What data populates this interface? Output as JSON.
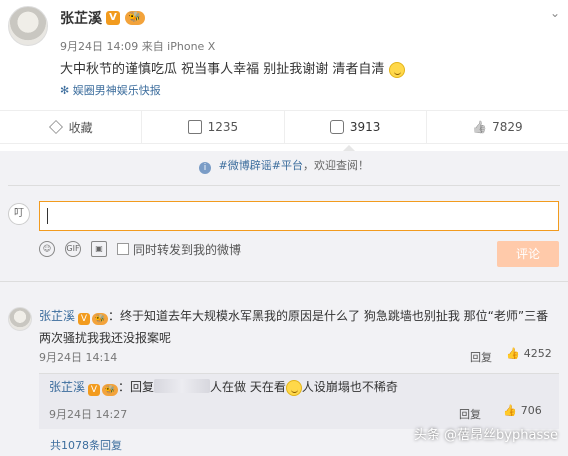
{
  "post": {
    "author": "张芷溪",
    "verified_badge": "V",
    "level_badge": "🐝",
    "meta": "9月24日 14:09 来自 iPhone X",
    "text": "大中秋节的谨慎吃瓜 祝当事人幸福 别扯我谢谢 清者自清",
    "source": "娱圈男神娱乐快报",
    "menu_icon": "chevron-down-icon"
  },
  "actions": {
    "favorite": "收藏",
    "share": "1235",
    "comment": "3913",
    "like": "7829"
  },
  "comments": {
    "notice_prefix": "",
    "notice_link": "#微博辟谣#平台",
    "notice_suffix": "，欢迎查阅！",
    "avatar_text": "叮",
    "input_value": "",
    "forward_label": "同时转发到我的微博",
    "submit": "评论",
    "first": {
      "author": "张芷溪",
      "text": "：终于知道去年大规模水军黑我的原因是什么了 狗急跳墙也别扯我 那位“老师”三番两次骚扰我我还没报案呢",
      "time": "9月24日 14:14",
      "reply": "回复",
      "likes": "4252"
    },
    "reply": {
      "author": "张芷溪",
      "prefix": "：回复",
      "text_a": "人在做 天在看",
      "text_b": "人设崩塌也不稀奇",
      "time": "9月24日 14:27",
      "reply": "回复",
      "likes": "706"
    },
    "more": "共1078条回复"
  },
  "watermark": "头条 @蓓昂丝byphasse",
  "colors": {
    "accent": "#f29b1e",
    "link": "#3c6d9d",
    "submit_disabled": "#ffcaaa"
  }
}
